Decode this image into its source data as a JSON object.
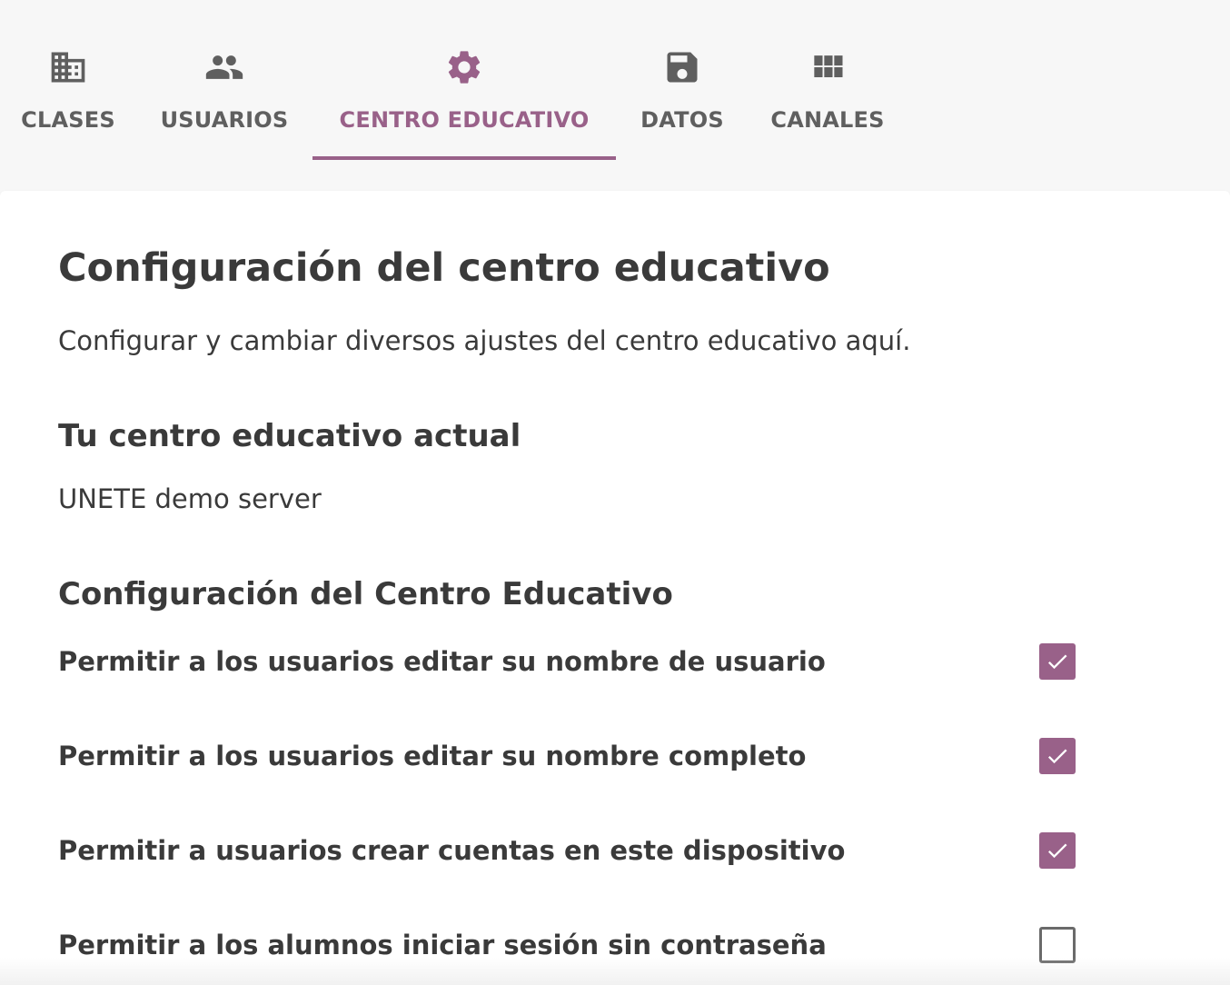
{
  "nav": {
    "tabs": [
      {
        "label": "CLASES",
        "icon": "building-icon"
      },
      {
        "label": "USUARIOS",
        "icon": "people-icon"
      },
      {
        "label": "CENTRO EDUCATIVO",
        "icon": "gear-icon",
        "active": true
      },
      {
        "label": "DATOS",
        "icon": "save-icon"
      },
      {
        "label": "CANALES",
        "icon": "grid-icon"
      }
    ]
  },
  "page": {
    "title": "Configuración del centro educativo",
    "subtitle": "Configurar y cambiar diversos ajustes del centro educativo aquí."
  },
  "current_facility": {
    "heading": "Tu centro educativo actual",
    "name": "UNETE demo server"
  },
  "settings": {
    "heading": "Configuración del Centro Educativo",
    "items": [
      {
        "label": "Permitir a los usuarios editar su nombre de usuario",
        "checked": true
      },
      {
        "label": "Permitir a los usuarios editar su nombre completo",
        "checked": true
      },
      {
        "label": "Permitir a usuarios crear cuentas en este dispositivo",
        "checked": true
      },
      {
        "label": "Permitir a los alumnos iniciar sesión sin contraseña",
        "checked": false
      }
    ]
  },
  "colors": {
    "accent": "#996189",
    "nav_text": "#5f5f5f",
    "body_text": "#3a3a3a",
    "background": "#f7f7f7"
  }
}
